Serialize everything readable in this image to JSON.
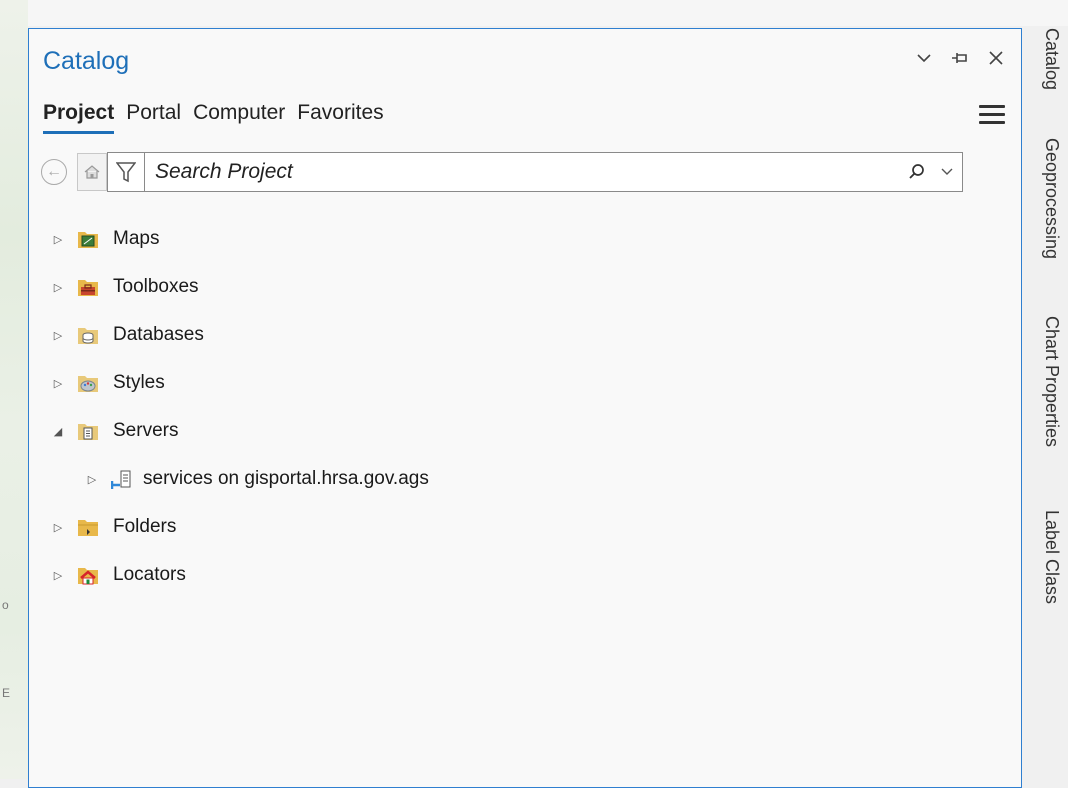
{
  "map_strip": {
    "fragments": [
      "o",
      "E"
    ]
  },
  "pane": {
    "title": "Catalog",
    "controls": {
      "options_icon": "chevron-down-icon",
      "pin_icon": "pin-icon",
      "close_icon": "close-icon"
    },
    "tabs": [
      {
        "label": "Project",
        "active": true
      },
      {
        "label": "Portal",
        "active": false
      },
      {
        "label": "Computer",
        "active": false
      },
      {
        "label": "Favorites",
        "active": false
      }
    ],
    "search": {
      "placeholder": "Search Project"
    },
    "tree": [
      {
        "label": "Maps",
        "expanded": false,
        "icon": "maps-folder-icon"
      },
      {
        "label": "Toolboxes",
        "expanded": false,
        "icon": "toolboxes-folder-icon"
      },
      {
        "label": "Databases",
        "expanded": false,
        "icon": "databases-folder-icon"
      },
      {
        "label": "Styles",
        "expanded": false,
        "icon": "styles-folder-icon"
      },
      {
        "label": "Servers",
        "expanded": true,
        "icon": "servers-folder-icon"
      },
      {
        "label": "services on gisportal.hrsa.gov.ags",
        "expanded": false,
        "icon": "server-connection-icon",
        "child": true
      },
      {
        "label": "Folders",
        "expanded": false,
        "icon": "folders-folder-icon"
      },
      {
        "label": "Locators",
        "expanded": false,
        "icon": "locators-folder-icon"
      }
    ]
  },
  "side_tabs": [
    "Catalog",
    "Geoprocessing",
    "Chart Properties",
    "Label Class"
  ],
  "colors": {
    "accent": "#1e6fb8",
    "folder": "#e8b84a",
    "pane_border": "#2f7fd0"
  }
}
